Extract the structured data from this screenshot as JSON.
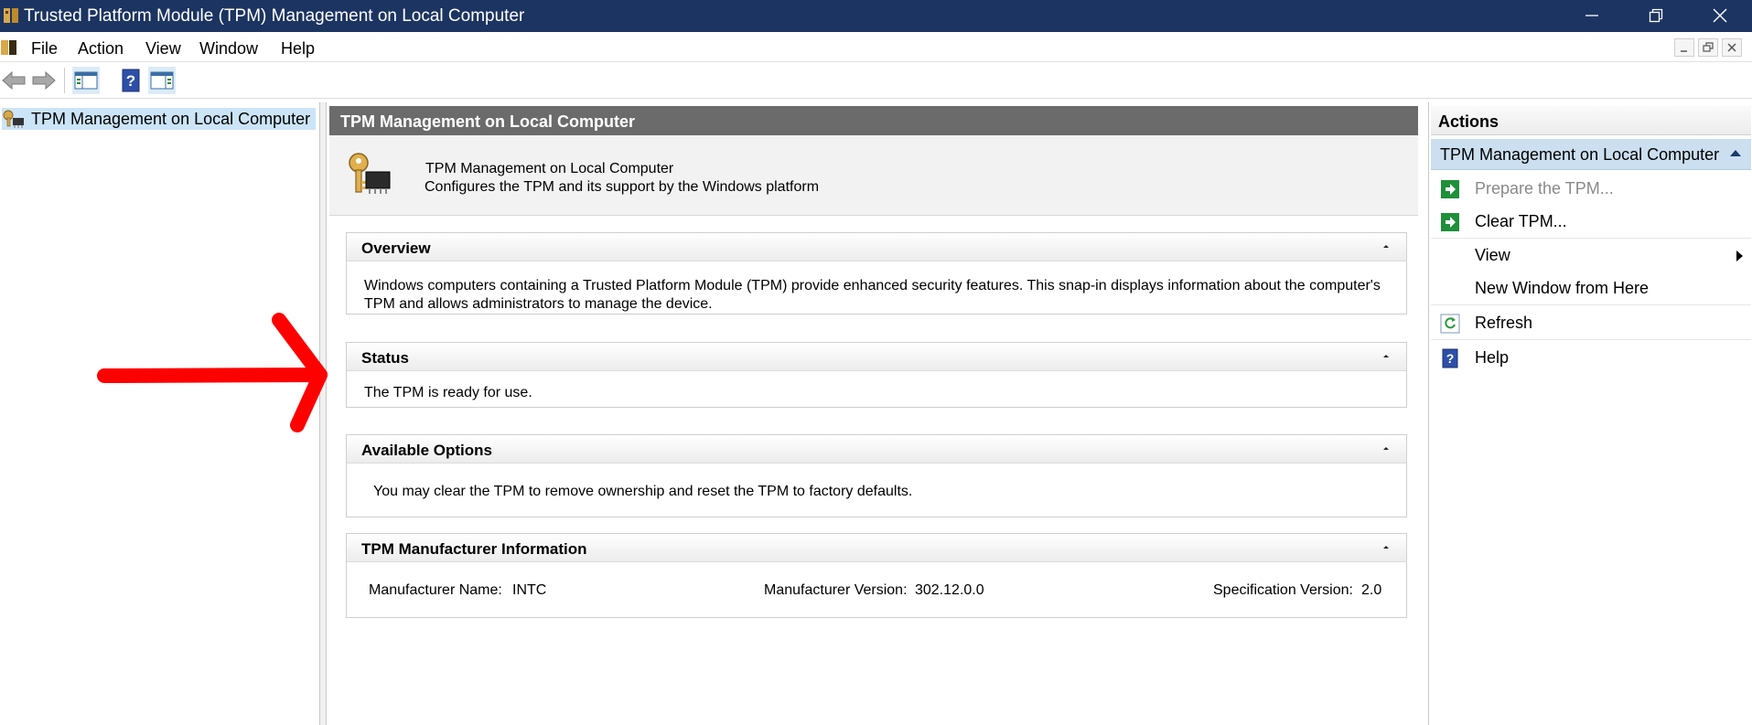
{
  "window": {
    "title": "Trusted Platform Module (TPM) Management on Local Computer"
  },
  "menu": {
    "items": [
      "File",
      "Action",
      "View",
      "Window",
      "Help"
    ]
  },
  "toolbar": {
    "icons": [
      "back-arrow-icon",
      "forward-arrow-icon",
      "show-hide-tree-icon",
      "help-icon",
      "show-hide-action-pane-icon"
    ]
  },
  "tree": {
    "root_label": "TPM Management on Local Computer"
  },
  "center": {
    "header": "TPM Management on Local Computer",
    "desc_title": "TPM Management on Local Computer",
    "desc_subtitle": "Configures the TPM and its support by the Windows platform",
    "overview": {
      "title": "Overview",
      "text": "Windows computers containing a Trusted Platform Module (TPM) provide enhanced security features. This snap-in displays information about the computer's TPM and allows administrators to manage the device."
    },
    "status": {
      "title": "Status",
      "text": "The TPM is ready for use."
    },
    "options": {
      "title": "Available Options",
      "text": "You may clear the TPM to remove ownership and reset the TPM to factory defaults."
    },
    "manufacturer": {
      "title": "TPM Manufacturer Information",
      "name_label": "Manufacturer Name:",
      "name_value": "INTC",
      "version_label": "Manufacturer Version:",
      "version_value": "302.12.0.0",
      "spec_label": "Specification Version:",
      "spec_value": "2.0"
    }
  },
  "actions": {
    "header": "Actions",
    "group": "TPM Management on Local Computer",
    "items": [
      {
        "label": "Prepare the TPM...",
        "icon": "green-action-arrow-icon",
        "disabled": true
      },
      {
        "label": "Clear TPM...",
        "icon": "green-action-arrow-icon",
        "disabled": false
      },
      {
        "label": "View",
        "icon": "",
        "disabled": false
      },
      {
        "label": "New Window from Here",
        "icon": "",
        "disabled": false
      },
      {
        "label": "Refresh",
        "icon": "refresh-icon",
        "disabled": false
      },
      {
        "label": "Help",
        "icon": "help-icon",
        "disabled": false
      }
    ]
  },
  "colors": {
    "titlebar": "#1c3461",
    "center_header": "#6b6b6b",
    "selection": "#cce4f7",
    "actions_group": "#cbdff0",
    "annotation_arrow": "#ff0000"
  }
}
